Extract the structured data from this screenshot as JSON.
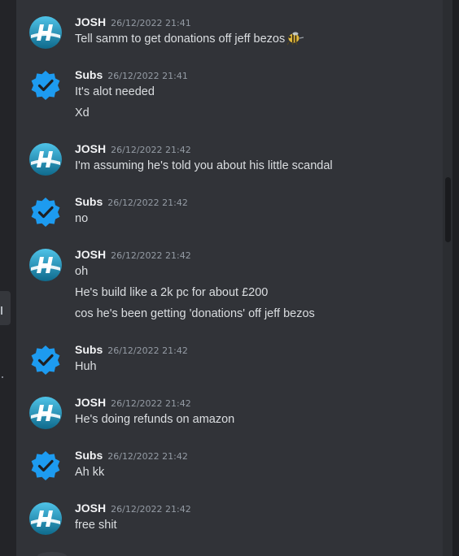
{
  "colors": {
    "bg": "#313338",
    "username": "#f2f3f5",
    "text": "#dbdee1",
    "timestamp": "#949ba4",
    "verified_blue": "#1d9bf0",
    "josh_avatar_teal": "#1a7fa0"
  },
  "messages": [
    {
      "author": "JOSH",
      "timestamp": "26/12/2022 21:41",
      "avatar_icon": "h-logo-icon",
      "lines": [
        "Tell samm to get donations off jeff bezos"
      ],
      "emoji": "cartoon-bee-emoji"
    },
    {
      "author": "Subs",
      "timestamp": "26/12/2022 21:41",
      "avatar_icon": "verified-badge-icon",
      "lines": [
        "It's alot needed",
        "Xd"
      ]
    },
    {
      "author": "JOSH",
      "timestamp": "26/12/2022 21:42",
      "avatar_icon": "h-logo-icon",
      "lines": [
        "I'm assuming he's told you about his little scandal"
      ]
    },
    {
      "author": "Subs",
      "timestamp": "26/12/2022 21:42",
      "avatar_icon": "verified-badge-icon",
      "lines": [
        "no"
      ]
    },
    {
      "author": "JOSH",
      "timestamp": "26/12/2022 21:42",
      "avatar_icon": "h-logo-icon",
      "lines": [
        "oh",
        "He's build like a 2k pc for about £200",
        "cos he's been getting 'donations' off jeff bezos"
      ]
    },
    {
      "author": "Subs",
      "timestamp": "26/12/2022 21:42",
      "avatar_icon": "verified-badge-icon",
      "lines": [
        "Huh"
      ]
    },
    {
      "author": "JOSH",
      "timestamp": "26/12/2022 21:42",
      "avatar_icon": "h-logo-icon",
      "lines": [
        "He's doing refunds on amazon"
      ]
    },
    {
      "author": "Subs",
      "timestamp": "26/12/2022 21:42",
      "avatar_icon": "verified-badge-icon",
      "lines": [
        "Ah kk"
      ]
    },
    {
      "author": "JOSH",
      "timestamp": "26/12/2022 21:42",
      "avatar_icon": "h-logo-icon",
      "lines": [
        "free shit"
      ]
    }
  ]
}
